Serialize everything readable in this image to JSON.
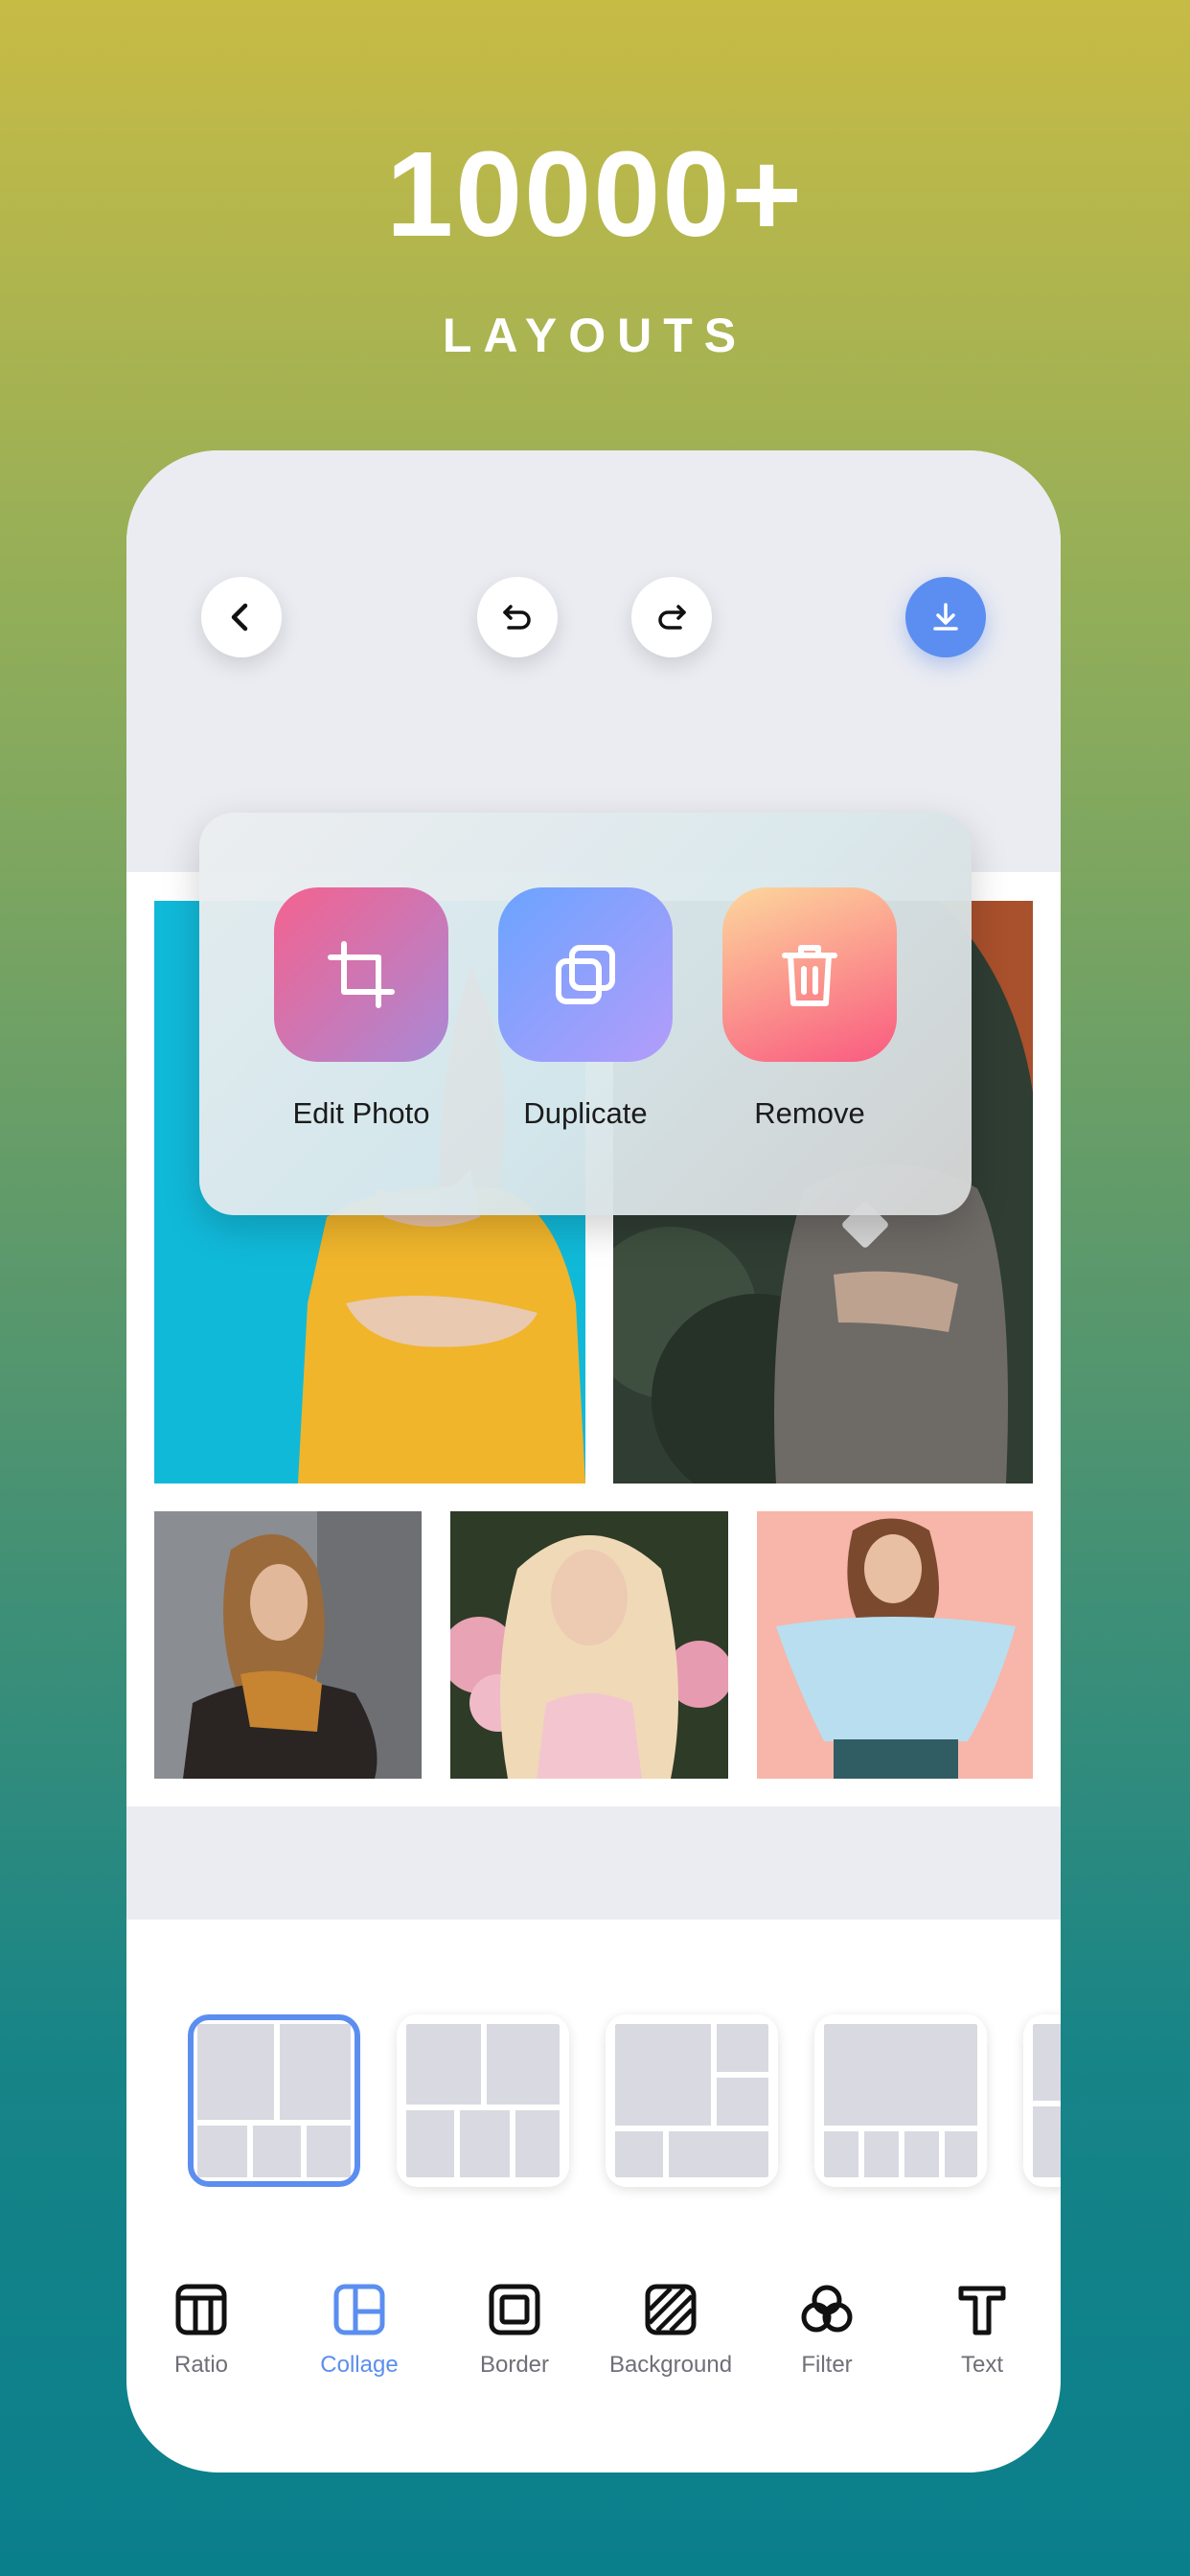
{
  "hero": {
    "headline": "10000+",
    "subheadline": "LAYOUTS"
  },
  "toolbar": {
    "back_icon": "chevron-left-icon",
    "undo_icon": "undo-icon",
    "redo_icon": "redo-icon",
    "save_icon": "download-icon",
    "accent_color": "#5b8ef0"
  },
  "popup": {
    "actions": [
      {
        "label": "Edit Photo",
        "icon": "crop-icon",
        "gradient": [
          "#f4628f",
          "#a989d6"
        ]
      },
      {
        "label": "Duplicate",
        "icon": "duplicate-icon",
        "gradient": [
          "#6aa4ff",
          "#b49cfa"
        ]
      },
      {
        "label": "Remove",
        "icon": "trash-icon",
        "gradient": [
          "#fdd79c",
          "#f95a80"
        ]
      }
    ]
  },
  "collage_photos": [
    {
      "name": "woman-yellow-sweater",
      "background": "#0fb2d4"
    },
    {
      "name": "woman-grey-cardigan",
      "background": "#2f3d33"
    },
    {
      "name": "woman-leather-jacket",
      "background": "#8a8d92"
    },
    {
      "name": "woman-pink-flowers",
      "background": "#2d3b27"
    },
    {
      "name": "woman-blue-blouse",
      "background": "#f7b6a9"
    }
  ],
  "layout_options": {
    "selected_index": 0,
    "count_visible": 5,
    "selected_color": "#5b8ef0"
  },
  "bottom_tools": [
    {
      "label": "Ratio",
      "icon": "ratio-icon",
      "active": false
    },
    {
      "label": "Collage",
      "icon": "collage-icon",
      "active": true
    },
    {
      "label": "Border",
      "icon": "border-icon",
      "active": false
    },
    {
      "label": "Background",
      "icon": "background-icon",
      "active": false
    },
    {
      "label": "Filter",
      "icon": "filter-icon",
      "active": false
    },
    {
      "label": "Text",
      "icon": "text-icon",
      "active": false
    }
  ]
}
